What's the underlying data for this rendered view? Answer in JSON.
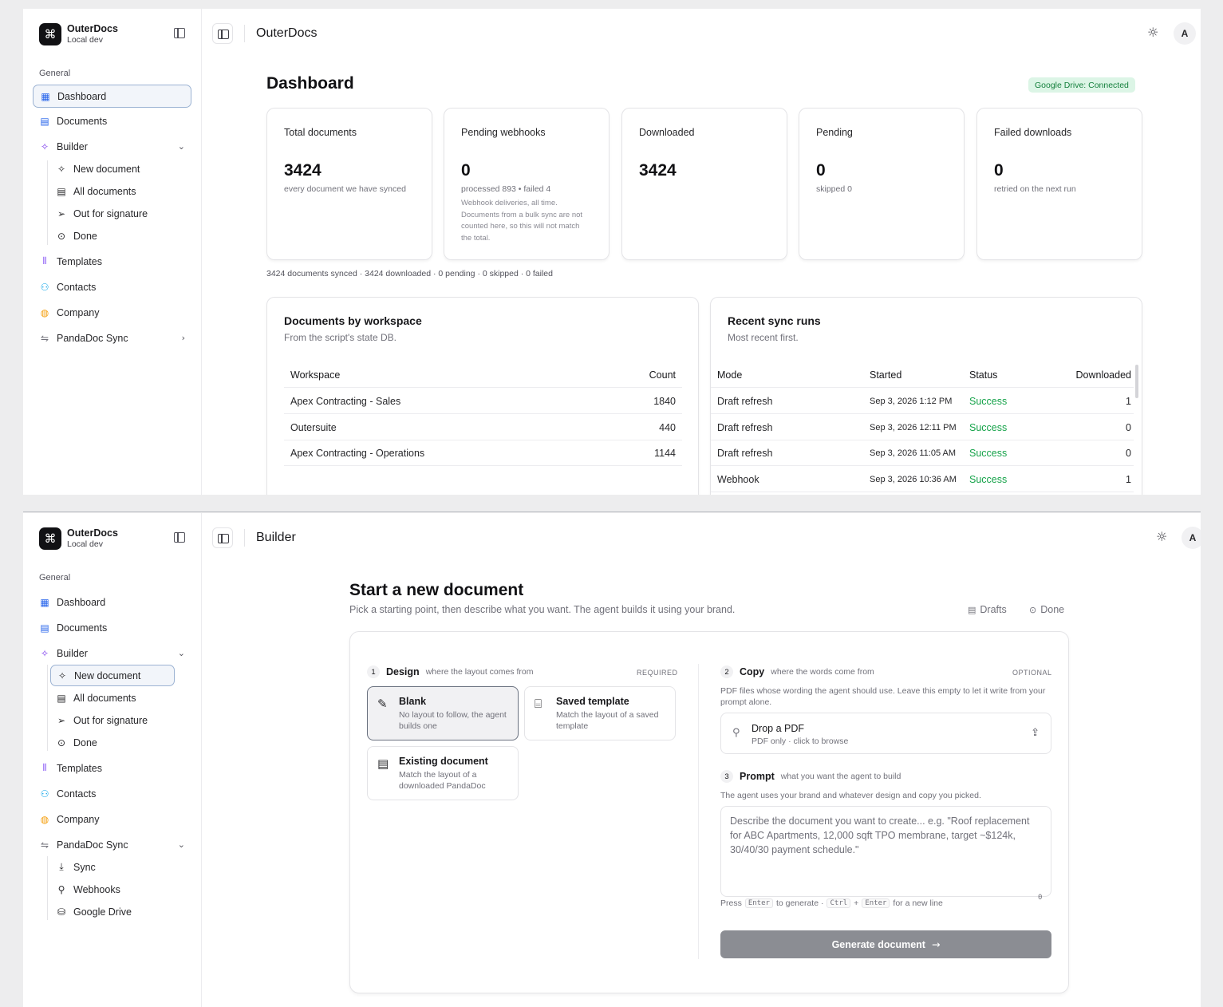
{
  "brand": {
    "name": "OuterDocs",
    "sub": "Local dev",
    "logo_icon": "⌘"
  },
  "sidebar": {
    "section": "General",
    "items": {
      "dashboard": "Dashboard",
      "documents": "Documents",
      "builder": "Builder",
      "templates": "Templates",
      "contacts": "Contacts",
      "company": "Company",
      "pandadoc": "PandaDoc Sync"
    },
    "builder_sub": {
      "new": "New document",
      "all": "All documents",
      "out": "Out for signature",
      "done": "Done"
    },
    "pandadoc_sub": {
      "sync": "Sync",
      "webhooks": "Webhooks",
      "drive": "Google Drive"
    },
    "icons": {
      "dashboard": "grid-icon",
      "documents": "file-icon",
      "builder": "sparkles-icon",
      "templates": "library-icon",
      "contacts": "users-icon",
      "company": "palette-icon",
      "pandadoc": "sync-icon"
    }
  },
  "dashboard": {
    "topbar_title": "OuterDocs",
    "avatar": "A",
    "title": "Dashboard",
    "drive_badge": "Google Drive: Connected",
    "stats": [
      {
        "title": "Total documents",
        "value": "3424",
        "sub": "every document we have synced",
        "note": ""
      },
      {
        "title": "Pending webhooks",
        "value": "0",
        "sub": "processed 893 • failed 4",
        "note": "Webhook deliveries, all time. Documents from a bulk sync are not counted here, so this will not match the total."
      },
      {
        "title": "Downloaded",
        "value": "3424",
        "sub": "",
        "note": ""
      },
      {
        "title": "Pending",
        "value": "0",
        "sub": "skipped 0",
        "note": ""
      },
      {
        "title": "Failed downloads",
        "value": "0",
        "sub": "retried on the next run",
        "note": ""
      }
    ],
    "summary": "3424 documents synced · 3424 downloaded · 0 pending · 0 skipped · 0 failed",
    "workspace_table": {
      "title": "Documents by workspace",
      "subtitle": "From the script's state DB.",
      "headers": [
        "Workspace",
        "Count"
      ],
      "rows": [
        [
          "Apex Contracting - Sales",
          "1840"
        ],
        [
          "Outersuite",
          "440"
        ],
        [
          "Apex Contracting - Operations",
          "1144"
        ]
      ]
    },
    "sync_table": {
      "title": "Recent sync runs",
      "subtitle": "Most recent first.",
      "headers": [
        "Mode",
        "Started",
        "Status",
        "Downloaded"
      ],
      "rows": [
        [
          "Draft refresh",
          "Sep 3, 2026 1:12 PM",
          "Success",
          "1"
        ],
        [
          "Draft refresh",
          "Sep 3, 2026 12:11 PM",
          "Success",
          "0"
        ],
        [
          "Draft refresh",
          "Sep 3, 2026 11:05 AM",
          "Success",
          "0"
        ],
        [
          "Webhook",
          "Sep 3, 2026 10:36 AM",
          "Success",
          "1"
        ]
      ]
    }
  },
  "builder": {
    "topbar_title": "Builder",
    "title": "Start a new document",
    "subtitle": "Pick a starting point, then describe what you want. The agent builds it using your brand.",
    "drafts_link": "Drafts",
    "done_link": "Done",
    "design": {
      "num": "1",
      "name": "Design",
      "desc": "where the layout comes from",
      "tag": "REQUIRED",
      "options": [
        {
          "title": "Blank",
          "sub": "No layout to follow, the agent builds one"
        },
        {
          "title": "Saved template",
          "sub": "Match the layout of a saved template"
        },
        {
          "title": "Existing document",
          "sub": "Match the layout of a downloaded PandaDoc"
        }
      ]
    },
    "copy": {
      "num": "2",
      "name": "Copy",
      "desc": "where the words come from",
      "tag": "OPTIONAL",
      "help": "PDF files whose wording the agent should use. Leave this empty to let it write from your prompt alone.",
      "drop_title": "Drop a PDF",
      "drop_sub": "PDF only · click to browse"
    },
    "prompt": {
      "num": "3",
      "name": "Prompt",
      "desc": "what you want the agent to build",
      "help": "The agent uses your brand and whatever design and copy you picked.",
      "placeholder": "Describe the document you want to create... e.g. \"Roof replacement for ABC Apartments, 12,000 sqft TPO membrane, target ~$124k, 30/40/30 payment schedule.\"",
      "counter": "0",
      "hint_press": "Press",
      "hint_enter": "Enter",
      "hint_generate": "to generate ·",
      "hint_ctrl": "Ctrl",
      "hint_plus": "+",
      "hint_enter2": "Enter",
      "hint_newline": "for a new line"
    },
    "generate_label": "Generate document"
  }
}
